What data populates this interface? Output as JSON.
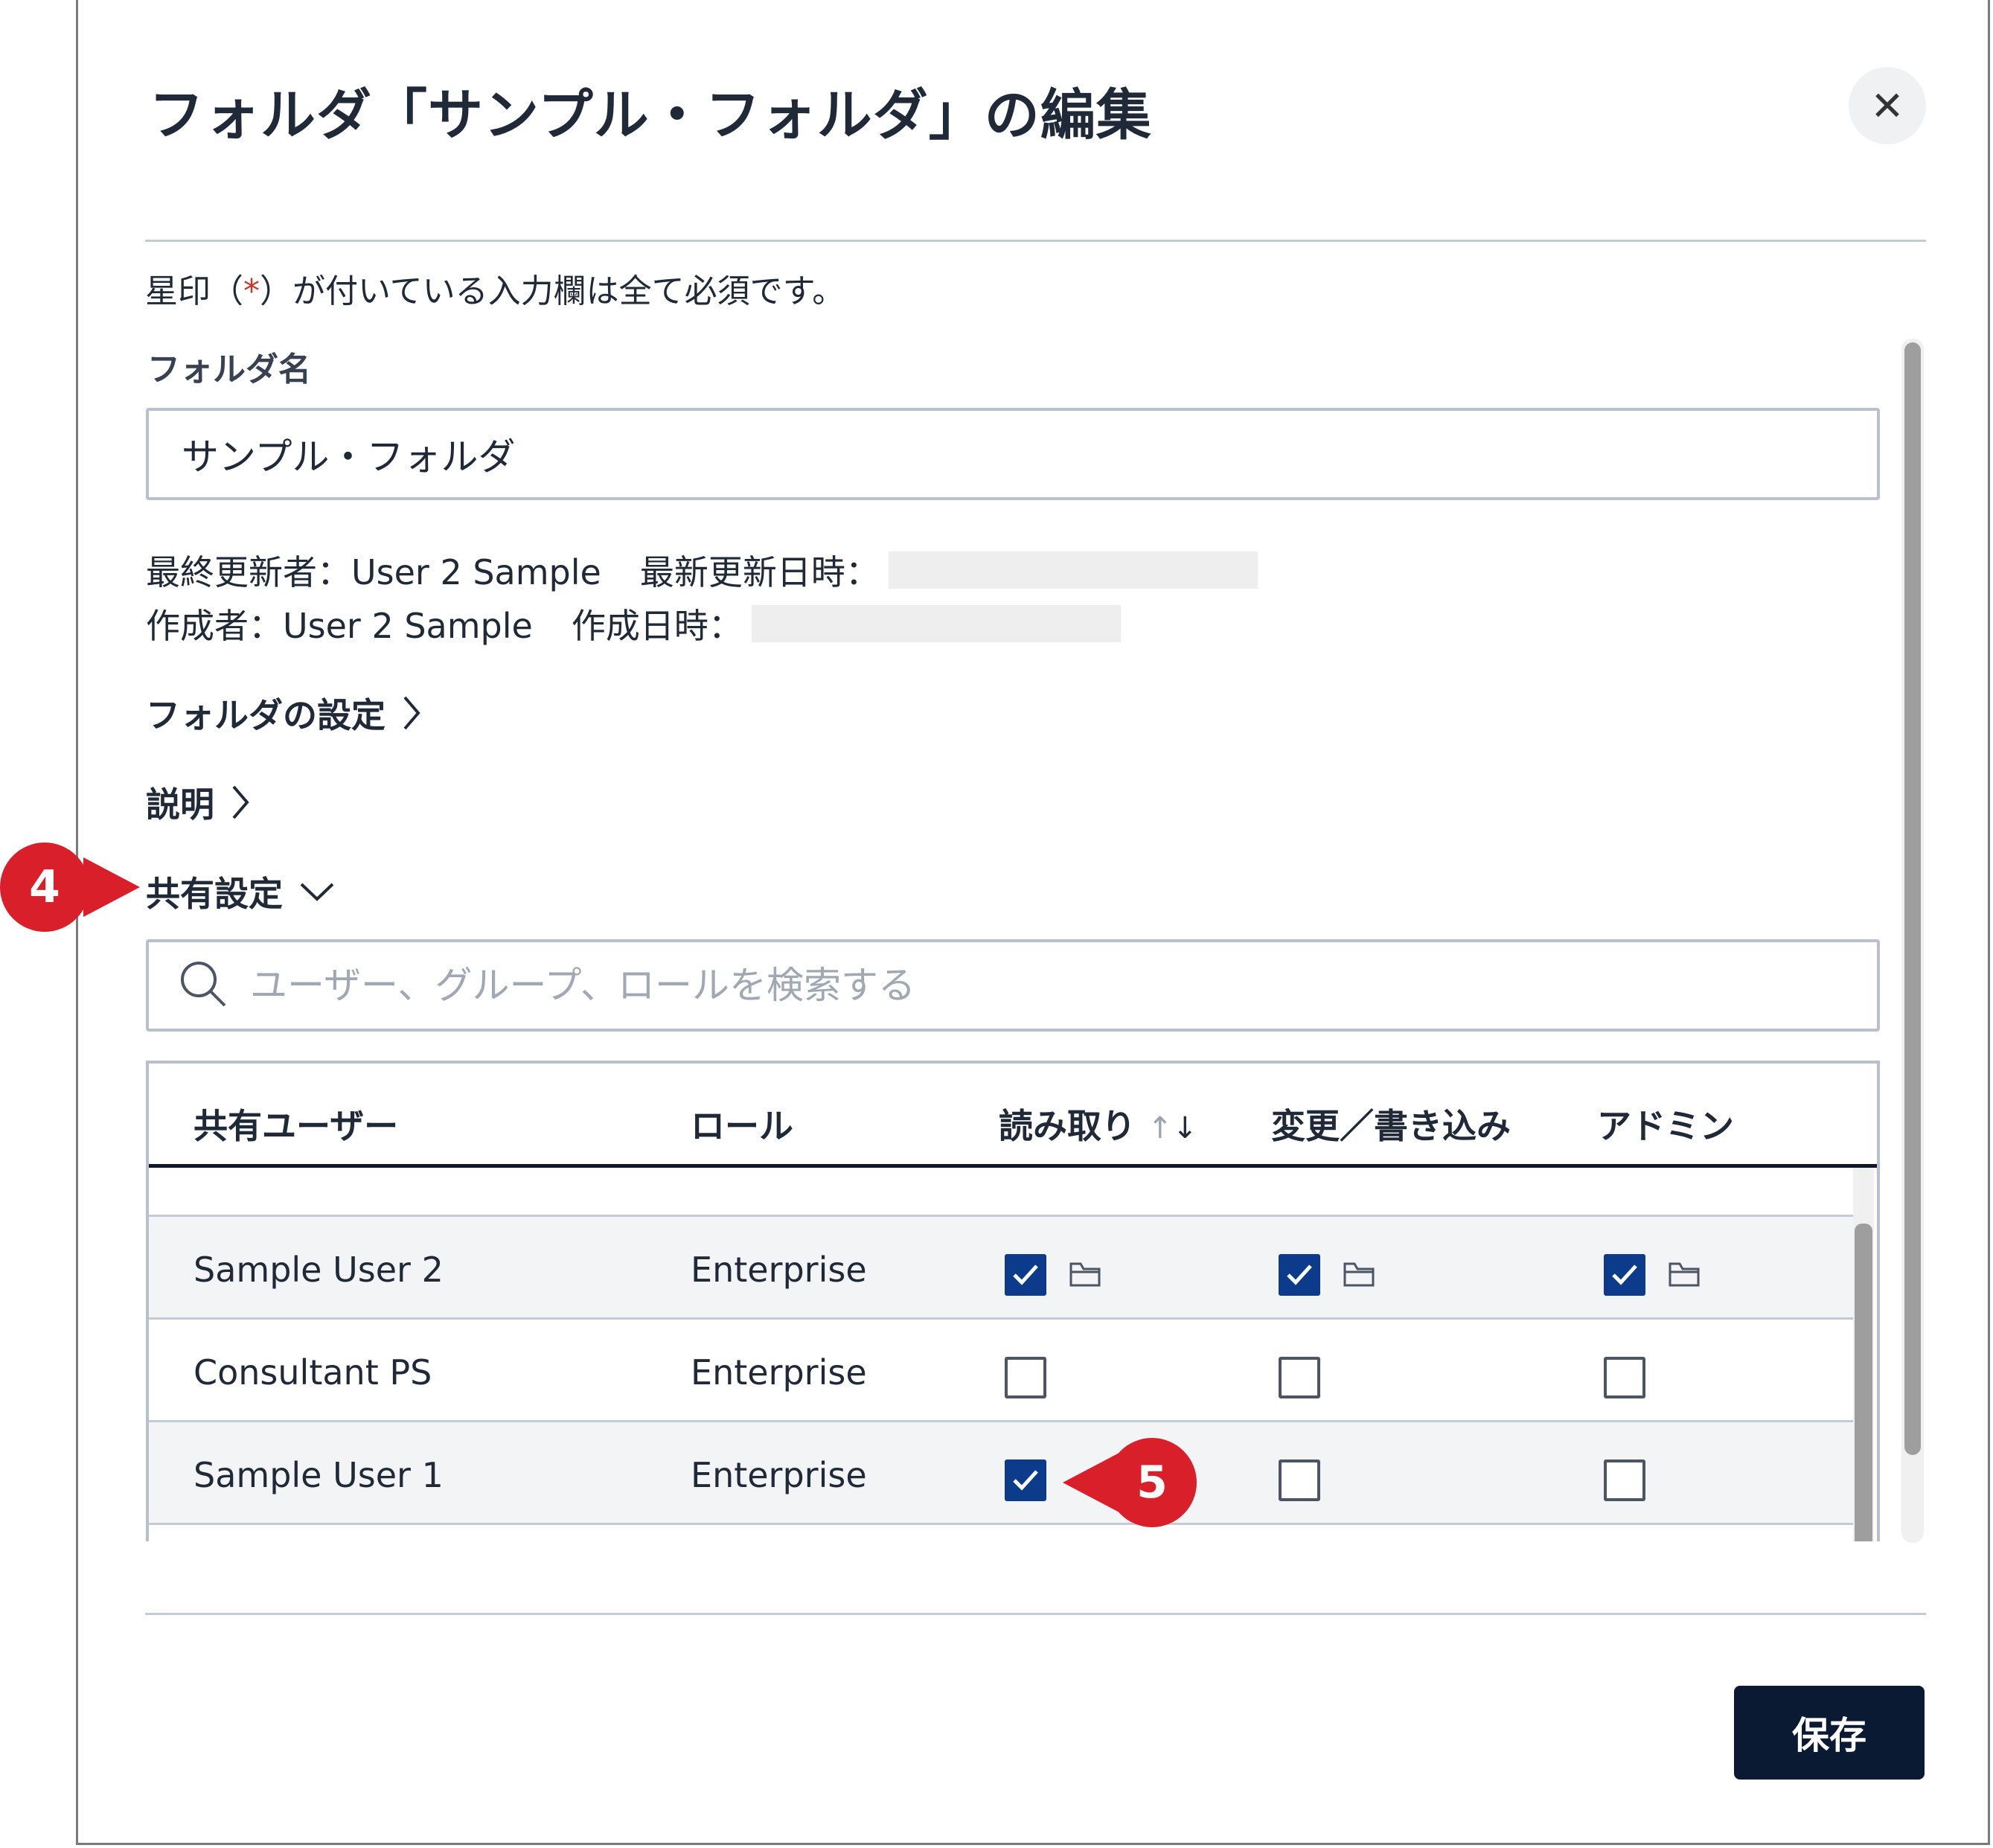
{
  "dialog": {
    "title": "フォルダ「サンプル・フォルダ」の編集",
    "close_glyph": "✕"
  },
  "form": {
    "required_note_pre": "星印（",
    "required_star": "*",
    "required_note_post": "）が付いている入力欄は全て必須です。",
    "folder_name_label": "フォルダ名",
    "folder_name_value": "サンプル・フォルダ",
    "updated_by": "最終更新者：User 2 Sample",
    "updated_at_label": "最新更新日時：",
    "created_by": "作成者：User 2 Sample",
    "created_at_label": "作成日時："
  },
  "sections": {
    "folder_settings": "フォルダの設定",
    "description": "説明",
    "sharing": "共有設定"
  },
  "search": {
    "placeholder": "ユーザー、グループ、ロールを検索する"
  },
  "table": {
    "columns": [
      "共有ユーザー",
      "ロール",
      "読み取り",
      "変更／書き込み",
      "アドミン"
    ],
    "sort_up": "↑",
    "sort_down": "↓",
    "rows": [
      {
        "user": "Sample User 2",
        "role": "Enterprise",
        "read": true,
        "write": true,
        "admin": true
      },
      {
        "user": "Consultant PS",
        "role": "Enterprise",
        "read": false,
        "write": false,
        "admin": false
      },
      {
        "user": "Sample User 1",
        "role": "Enterprise",
        "read": true,
        "write": false,
        "admin": false
      }
    ]
  },
  "footer": {
    "save_label": "保存"
  },
  "callouts": {
    "four": "4",
    "five": "5"
  },
  "colors": {
    "primary": "#0b1a33",
    "checkbox_checked": "#0d3b8c",
    "callout": "#d9202a"
  },
  "icons": [
    "close-icon",
    "chevron-right-icon",
    "chevron-down-icon",
    "search-icon",
    "sort-icon",
    "check-icon",
    "folder-icon"
  ]
}
